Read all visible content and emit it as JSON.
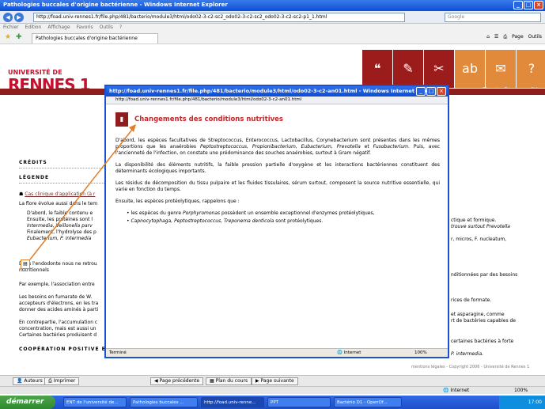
{
  "window": {
    "title": "Pathologies buccales d'origine bactérienne - Windows Internet Explorer",
    "address": "http://foad.univ-rennes1.fr/file.php/481/bacterio/module3/html/odo02-3-c2-sc2_odo02-3-c2-sc2_odo02-3-c2-sc2-p1_1.html",
    "search_placeholder": "Google",
    "menu": [
      "Fichier",
      "Edition",
      "Affichage",
      "Favoris",
      "Outils",
      "?"
    ],
    "tab_label": "Pathologies buccales d'origine bactérienne",
    "tools": [
      "Page",
      "Outils"
    ]
  },
  "page": {
    "logo_top": "UNIVERSITÉ DE",
    "logo_main": "RENNES 1",
    "tile_labels": [
      "Glossaire",
      "Ressources",
      "Aide"
    ],
    "credits_label": "CRÉDITS",
    "legend_label": "LÉGENDE",
    "case_link": "Cas clinique d'application (à r",
    "paragraphs": [
      "La flore évolue aussi dans le tem",
      "D'abord, le faible contenu e",
      "Ensuite, les protéines sont l",
      "Intermedia, Veillonella parv",
      "Finalement, l'hydrolyse des p",
      "Eubacterium, P. intermedia"
    ],
    "right_fragments": [
      "ctique et formique.",
      "trouve surtout Prevotella",
      "r, micros, F. nucleatum,"
    ],
    "endo_p1": "Dans l'endodonte nous ne retrou",
    "endo_p2": "nutritionnels",
    "endo_right": "nditionnées par des besoins",
    "example_p": "Par exemple, l'association entre",
    "example_right": "rices de formate.",
    "needs_p1": "Les besoins en fumarate de W.",
    "needs_p2": "accepteurs d'électrons, en les tra",
    "needs_p3": "donner des acides aminés à parti",
    "needs_right1": "et asparagine, comme",
    "needs_right2": "rt de bactéries capables de",
    "contra_p1": "En contrepartie, l'accumulation c",
    "contra_p2": "concentration, mais est aussi un",
    "contra_p3": "Certaines bactéries produisent d",
    "contra_right1": "certaines bactéries à forte",
    "contra_right2": "P. intermedia.",
    "coop_title": "COOPÉRATION POSITIVE ENTRE ESPÈCES BACTÉRIENNES ENDOCANALAIRES",
    "footer": "mentions légales - Copyright 2006 - Université de Rennes 1"
  },
  "page_toolbar": {
    "authors": "Auteurs",
    "print": "Imprimer",
    "prev": "Page précédente",
    "plan": "Plan du cours",
    "next": "Page suivante"
  },
  "ie_status": {
    "zone": "Internet",
    "zoom": "100%"
  },
  "popup": {
    "title": "http://foad.univ-rennes1.fr/file.php/481/bacterio/module3/html/odo02-3-c2-an01.html - Windows Internet Exp...",
    "address": "http://foad.univ-rennes1.fr/file.php/481/bacterio/module3/html/odo02-3-c2-an01.html",
    "heading": "Changements des conditions nutritives",
    "p1_a": "D'abord, les espèces facultatives de Streptococcus, Enterococcus, Lactobacillus, Corynebacterium sont présentes dans les mêmes proportions que les anaérobies ",
    "p1_i1": "Peptostreptococcus, Propionibacterium, Eubacterium, Prevotella",
    "p1_b": " et ",
    "p1_i2": "Fusobacterium",
    "p1_c": ". Puis, avec l'ancienneté de l'infection, on constate une prédominance des souches anaérobies, surtout à Gram négatif.",
    "p2": "La disponibilité des éléments nutritifs, la faible pression partielle d'oxygène et les interactions bactériennes constituent des déterminants écologiques importants.",
    "p3": "Les résidus de décomposition du tissu pulpaire et les fluides tissulaires, sérum surtout, composent la source nutritive essentielle, qui varie en fonction du temps.",
    "p4": "Ensuite, les espèces protéolytiques,  rappelons que :",
    "li1_a": "les espèces du genre ",
    "li1_i": "Porphyromonas",
    "li1_b": " possèdent un ensemble exceptionnel d'enzymes protéolytiques,",
    "li2_i1": "Capnocytophaga, Peptostreptococcus, Treponema denticola",
    "li2_b": " sont protéolytiques.",
    "status_left": "Terminé",
    "status_zone": "Internet",
    "status_zoom": "100%"
  },
  "taskbar": {
    "start": "démarrer",
    "tasks": [
      "ENT de l'université de...",
      "Pathologies buccales ...",
      "http://foad.univ-renne...",
      "PPT",
      "Bactério D1 - OpenOf..."
    ],
    "clock": "17:00"
  },
  "colors": {
    "accent_red": "#8e1d1d",
    "heading_red": "#c0282b",
    "orange": "#e28a3b",
    "xp_blue": "#1a52d6"
  }
}
